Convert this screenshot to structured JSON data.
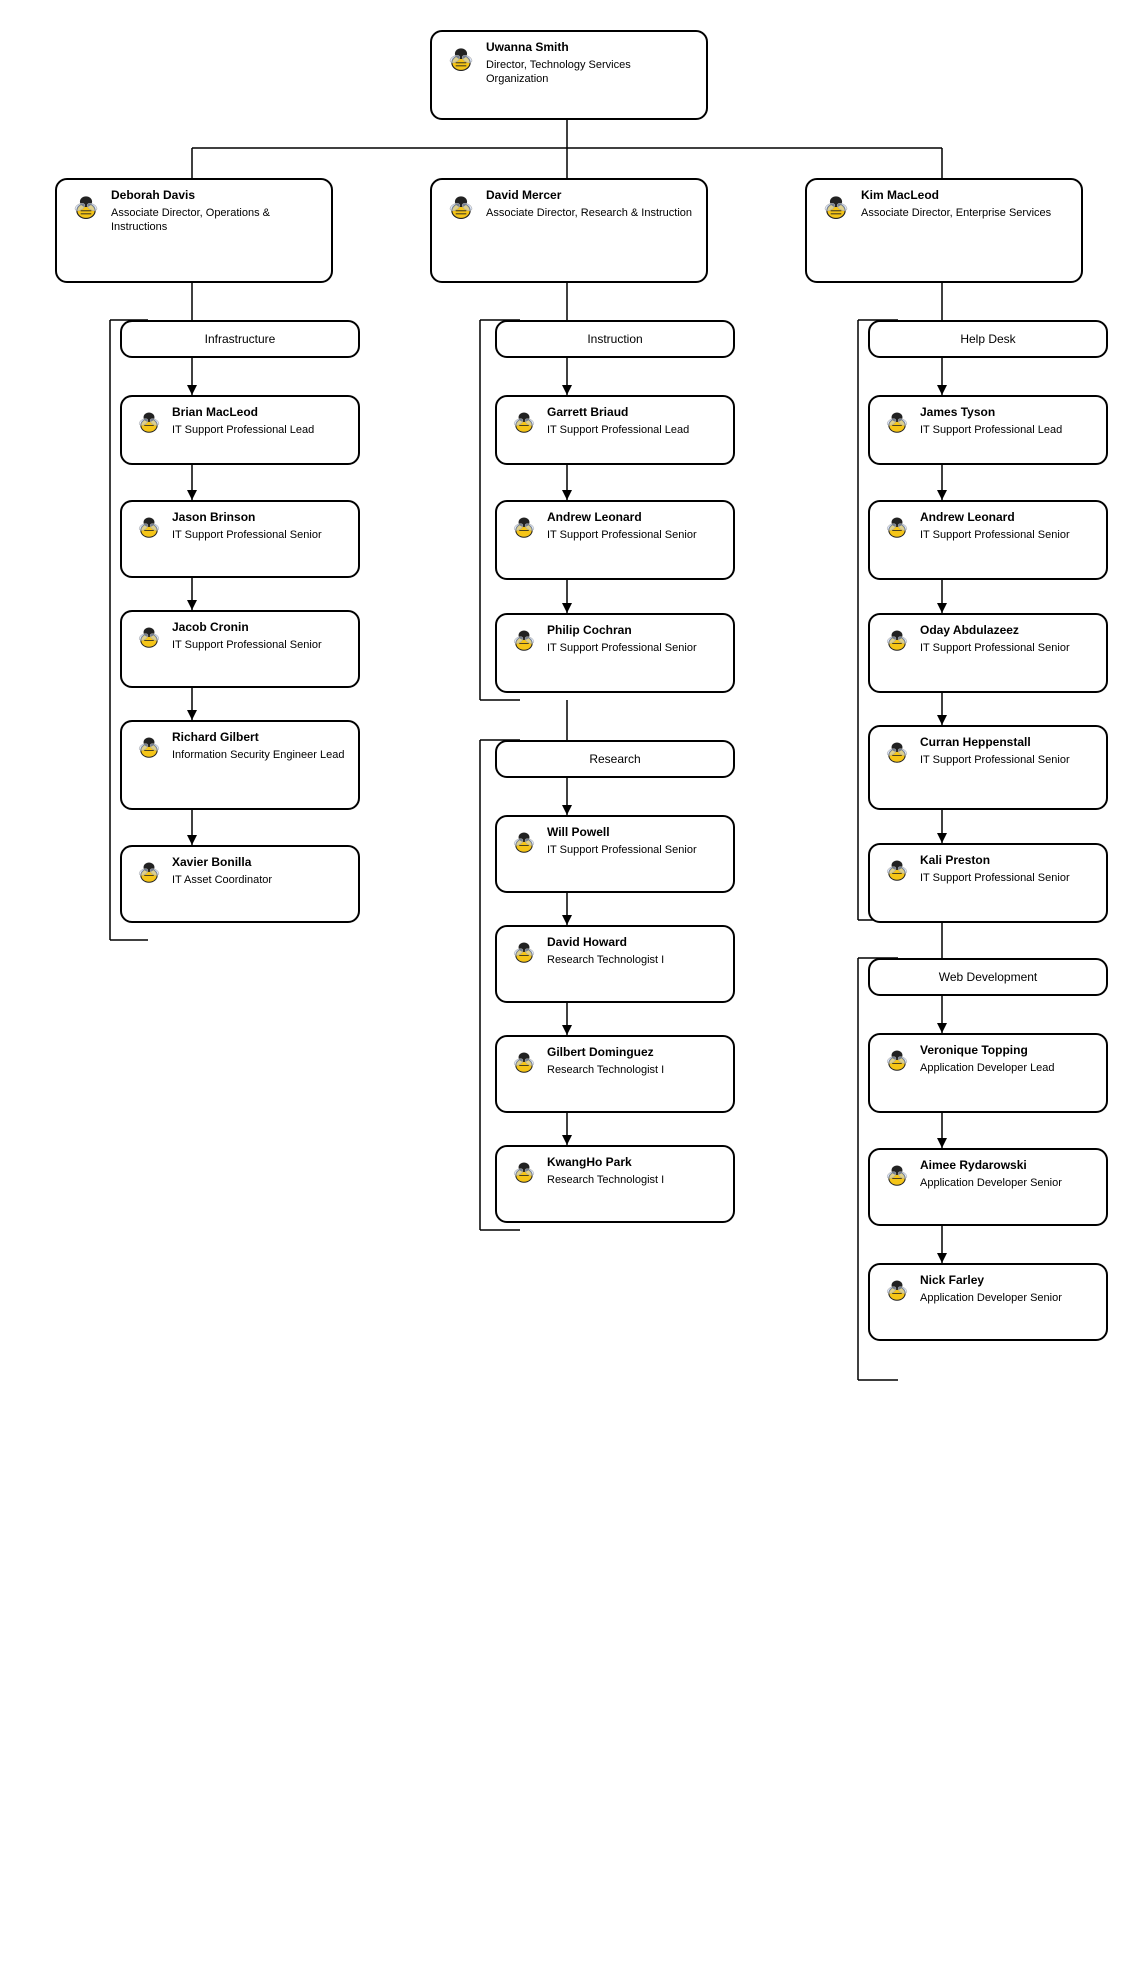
{
  "nodes": {
    "root": {
      "name": "Uwanna Smith",
      "title": "Director, Technology Services Organization"
    },
    "deborah": {
      "name": "Deborah Davis",
      "title": "Associate Director, Operations & Instructions"
    },
    "david_mercer": {
      "name": "David Mercer",
      "title": "Associate Director, Research & Instruction"
    },
    "kim": {
      "name": "Kim MacLeod",
      "title": "Associate Director, Enterprise Services"
    },
    "infrastructure": {
      "label": "Infrastructure"
    },
    "instruction": {
      "label": "Instruction"
    },
    "helpdesk": {
      "label": "Help Desk"
    },
    "research": {
      "label": "Research"
    },
    "webdev": {
      "label": "Web Development"
    },
    "brian": {
      "name": "Brian MacLeod",
      "title": "IT Support Professional Lead"
    },
    "jason": {
      "name": "Jason Brinson",
      "title": "IT Support Professional Senior"
    },
    "jacob": {
      "name": "Jacob Cronin",
      "title": "IT Support Professional Senior"
    },
    "richard": {
      "name": "Richard Gilbert",
      "title": "Information Security Engineer Lead"
    },
    "xavier": {
      "name": "Xavier Bonilla",
      "title": "IT Asset Coordinator"
    },
    "garrett": {
      "name": "Garrett Briaud",
      "title": "IT Support Professional Lead"
    },
    "andrew_mid": {
      "name": "Andrew Leonard",
      "title": "IT Support Professional Senior"
    },
    "philip": {
      "name": "Philip Cochran",
      "title": "IT Support Professional Senior"
    },
    "will": {
      "name": "Will Powell",
      "title": "IT Support Professional Senior"
    },
    "david_howard": {
      "name": "David Howard",
      "title": "Research Technologist I"
    },
    "gilbert": {
      "name": "Gilbert Dominguez",
      "title": "Research Technologist I"
    },
    "kwangho": {
      "name": "KwangHo Park",
      "title": "Research Technologist I"
    },
    "james": {
      "name": "James Tyson",
      "title": "IT Support Professional Lead"
    },
    "andrew_right": {
      "name": "Andrew Leonard",
      "title": "IT Support Professional Senior"
    },
    "oday": {
      "name": "Oday Abdulazeez",
      "title": "IT Support Professional Senior"
    },
    "curran": {
      "name": "Curran Heppenstall",
      "title": "IT Support Professional Senior"
    },
    "kali": {
      "name": "Kali Preston",
      "title": "IT Support Professional Senior"
    },
    "veronique": {
      "name": "Veronique Topping",
      "title": "Application Developer Lead"
    },
    "aimee": {
      "name": "Aimee Rydarowski",
      "title": "Application Developer Senior"
    },
    "nick": {
      "name": "Nick Farley",
      "title": "Application Developer Senior"
    }
  }
}
